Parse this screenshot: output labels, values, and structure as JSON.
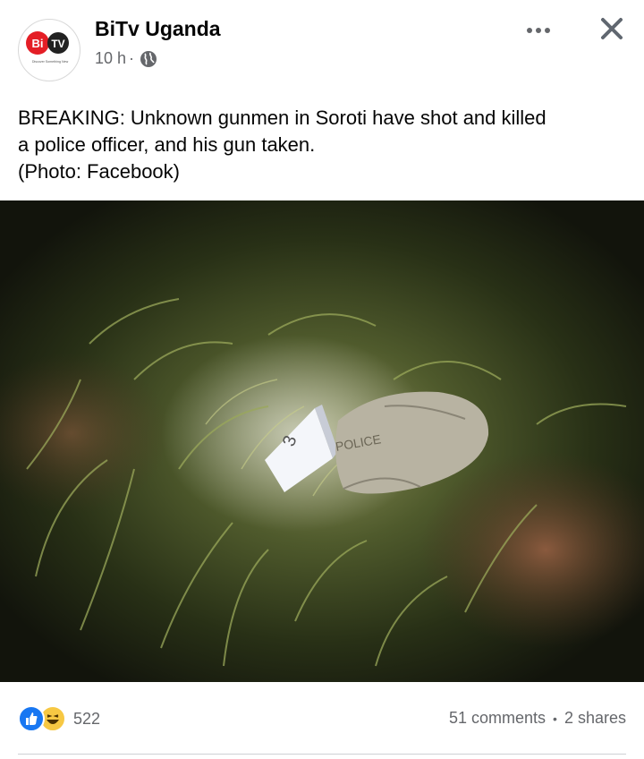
{
  "post": {
    "page_name": "BiTv Uganda",
    "time": "10 h",
    "separator": "·",
    "privacy_icon": "globe-icon",
    "avatar": {
      "logo_text_left": "Bi",
      "logo_text_right": "TV",
      "tagline": "Discover Something New"
    },
    "text_lines": [
      "BREAKING: Unknown gunmen in Soroti have shot and killed",
      "a police officer, and his gun taken.",
      "(Photo: Facebook)"
    ],
    "photo": {
      "marker_label": "3",
      "cap_label": "POLICE"
    }
  },
  "header_actions": {
    "more_icon": "more-horizontal-icon",
    "close_icon": "close-icon"
  },
  "engagement": {
    "reaction_icons": [
      "like-reaction-icon",
      "haha-reaction-icon"
    ],
    "reaction_count": "522",
    "comments": "51 comments",
    "separator": "•",
    "shares": "2 shares"
  },
  "colors": {
    "brand_red": "#e41e26",
    "like_blue": "#1877f2",
    "haha_yellow": "#f7c843",
    "secondary_text": "#65676b"
  }
}
